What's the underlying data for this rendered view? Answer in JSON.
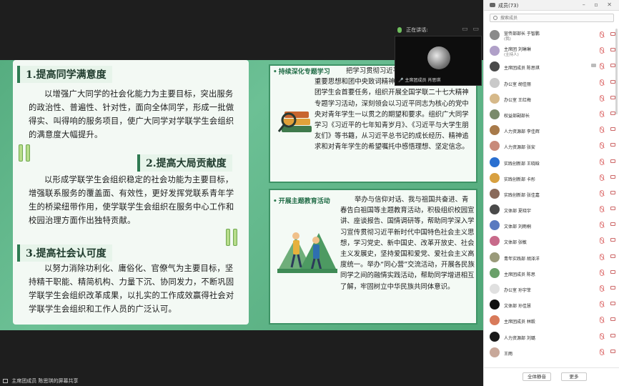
{
  "meeting": {
    "speaking_label": "正在讲话:",
    "speaker_tile_name": "主席团成员 肖思琪",
    "share_label": "主席团成员 陈思琪的屏幕共享"
  },
  "slide": {
    "sections": [
      {
        "title": "1.提高同学满意度",
        "text": "以增强广大同学的社会化能力为主要目标，突出服务的政治性、普遍性、针对性，面向全体同学，形成一批做得实、叫得响的服务项目，使广大同学对学联学生会组织的满意度大幅提升。"
      },
      {
        "title": "2.提高大局贡献度",
        "text": "以形成学联学生会组织稳定的社会功能为主要目标，增强联系服务的覆盖面、有效性，更好发挥党联系青年学生的桥梁纽带作用，使学联学生会组织在服务中心工作和校园治理方面作出独特贡献。"
      },
      {
        "title": "3.提高社会认可度",
        "text": "以努力消除功利化、庸俗化、官僚气为主要目标，坚持精干职能、精简机构、力量下沉、协同发力，不断巩固学联学生会组织改革成果，以扎实的工作成效赢得社会对学联学生会组织和工作人员的广泛认可。"
      }
    ],
    "boxes": [
      {
        "title": "持续深化专题学习",
        "text": "把学习贯彻习近平总书记关于青年工作的重要思想和团中央致词精神作为主要内容，作为主席团学生会首要任务，组织开展全国学联二十七大精神专题学习活动，深刻领会以习近平同志为核心的党中央对青年学生一以贯之的期望和要求。组织广大同学学习《习近平的七年知青岁月》、《习近平与大学生朋友们》等书籍，从习近平总书记的成长经历、精神追求和对青年学生的希望嘱托中感悟理想、坚定信念。"
      },
      {
        "title": "开展主题教育活动",
        "text": "举办与信仰对话、我与祖国共奋进、青春告白祖国等主题教育活动，积极组织校园宣讲、座谈报告、国情调研等，帮助同学深入学习宣传贯彻习近平新时代中国特色社会主义思想，学习党史、新中国史、改革开放史、社会主义发展史，坚持爱国和爱党、爱社会主义高度统一。举办“同心营”交流活动，开展各民族同学之间的融情实践活动，帮助同学增进相互了解，牢固树立中华民族共同体意识。"
      }
    ]
  },
  "participants_panel": {
    "title": "成员(73)",
    "search_placeholder": "搜索成员",
    "members": [
      {
        "name": "宣传部部长 于智鹏",
        "sub": "(我)",
        "color": "#8a8a8a"
      },
      {
        "name": "主席团 刘琳琳",
        "sub": "(主持人)",
        "color": "#b0a0c8"
      },
      {
        "name": "主席团成员 陈思琪",
        "sub": "",
        "color": "#4a4a4a"
      },
      {
        "name": "办公室 胡佳丽",
        "sub": "",
        "color": "#c9c9c9"
      },
      {
        "name": "办公室 王红梅",
        "sub": "",
        "color": "#d6b98a"
      },
      {
        "name": "权益部副部长",
        "sub": "",
        "color": "#7a8a6a"
      },
      {
        "name": "人力资源部 李佳辉",
        "sub": "",
        "color": "#a87a4a"
      },
      {
        "name": "人力资源部 张安",
        "sub": "",
        "color": "#c88a7a"
      },
      {
        "name": "实践创新部 王晓晗",
        "sub": "",
        "color": "#2a6fd0"
      },
      {
        "name": "实践创新部 卡彤",
        "sub": "",
        "color": "#d8a040"
      },
      {
        "name": "实践创新部 张佳嘉",
        "sub": "",
        "color": "#8a6a5a"
      },
      {
        "name": "文体部 夏晓宇",
        "sub": "",
        "color": "#4a4a4a"
      },
      {
        "name": "文体部 刘雨桐",
        "sub": "",
        "color": "#5a7ac0"
      },
      {
        "name": "文体部 张敏",
        "sub": "",
        "color": "#c86a8a"
      },
      {
        "name": "青年实践部 胡泽洋",
        "sub": "",
        "color": "#9a9a7a"
      },
      {
        "name": "主席团成员 陈思",
        "sub": "",
        "color": "#6aa06a"
      },
      {
        "name": "办公室 孙宇菲",
        "sub": "",
        "color": "#e0e0e0"
      },
      {
        "name": "文体部 孙佳慧",
        "sub": "",
        "color": "#111111"
      },
      {
        "name": "主席团成员 林毅",
        "sub": "",
        "color": "#d87a5a"
      },
      {
        "name": "人力资源部 刘璐",
        "sub": "",
        "color": "#1a1a1a"
      },
      {
        "name": "王雨",
        "sub": "",
        "color": "#c8a89a"
      }
    ],
    "mute_all_label": "全体静音",
    "more_label": "更多"
  }
}
